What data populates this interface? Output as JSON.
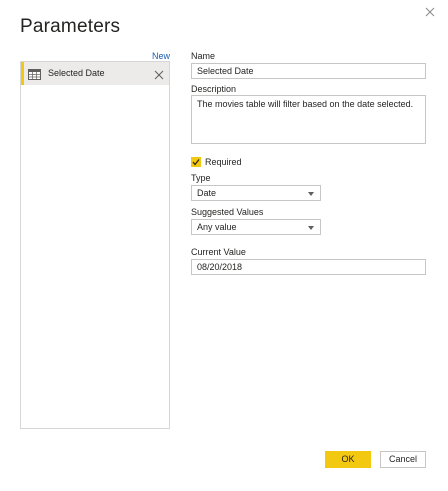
{
  "dialog": {
    "title": "Parameters",
    "new_label": "New"
  },
  "parameters": [
    {
      "label": "Selected Date",
      "icon": "table-icon",
      "selected": true
    }
  ],
  "form": {
    "name_label": "Name",
    "name_value": "Selected Date",
    "description_label": "Description",
    "description_value": "The movies table will filter based on the date selected.",
    "required_label": "Required",
    "required_checked": true,
    "type_label": "Type",
    "type_value": "Date",
    "suggested_label": "Suggested Values",
    "suggested_value": "Any value",
    "current_label": "Current Value",
    "current_value": "08/20/2018"
  },
  "buttons": {
    "ok_label": "OK",
    "cancel_label": "Cancel"
  },
  "colors": {
    "accent": "#f2c811",
    "link": "#1a5fb4",
    "border": "#c8c6c4",
    "selected_bg": "#edebe9"
  }
}
